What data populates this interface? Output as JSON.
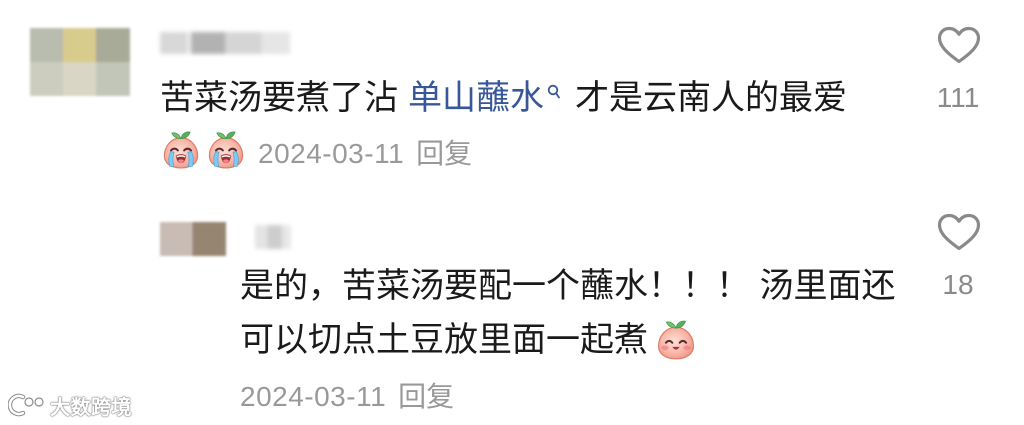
{
  "comment": {
    "text_before_link": "苦菜汤要煮了沾",
    "search_link_text": "单山蘸水",
    "search_link_icon": "search-icon",
    "text_after_link": "才是云南人的最爱",
    "emojis": [
      "crying-emoji-icon",
      "crying-emoji-icon"
    ],
    "date": "2024-03-11",
    "reply_label": "回复",
    "like_icon": "heart-icon",
    "like_count": "111"
  },
  "reply": {
    "lines": [
      "是的，苦菜汤要配一个蘸水！！！ 汤里面还",
      "可以切点土豆放里面一起煮"
    ],
    "emoji": "smiling-emoji-icon",
    "date": "2024-03-11",
    "reply_label": "回复",
    "like_icon": "heart-icon",
    "like_count": "18"
  },
  "watermark": {
    "logo_icon": "watermark-logo-icon",
    "text": "大数跨境"
  },
  "colors": {
    "text": "#1a1a1a",
    "link": "#385799",
    "muted": "#999999",
    "like": "#8a8a8a",
    "background": "#ffffff"
  }
}
